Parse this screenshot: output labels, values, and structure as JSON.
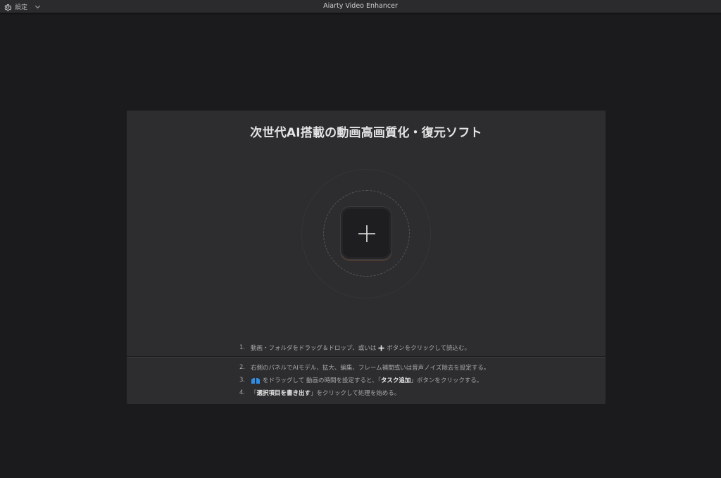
{
  "titlebar": {
    "settings_label": "設定",
    "app_title": "Aiarty Video Enhancer"
  },
  "main": {
    "headline": "次世代AI搭載の動画高画質化・復元ソフト"
  },
  "steps": [
    {
      "num": "1.",
      "pre": "動画・フォルダをドラッグ＆ドロップ、或いは",
      "post": "ボタンをクリックして読込む。"
    },
    {
      "num": "2.",
      "text": "右側のパネルでAIモデル、拡大、編集、フレーム補間或いは音声ノイズ除去を設定する。"
    },
    {
      "num": "3.",
      "pre": "をドラッグして 動画の時間を設定すると、「",
      "hl": "タスク追加",
      "post": "」ボタンをクリックする。"
    },
    {
      "num": "4.",
      "pre": "「",
      "hl": "選択項目を書き出す",
      "post": "」をクリックして処理を始める。"
    }
  ],
  "colors": {
    "background": "#1b1b1d",
    "panel": "#2d2d30",
    "accent_blue": "#2f8de4"
  },
  "icons": [
    "gear-icon",
    "chevron-down-icon",
    "plus-icon",
    "trim-handles-icon"
  ]
}
